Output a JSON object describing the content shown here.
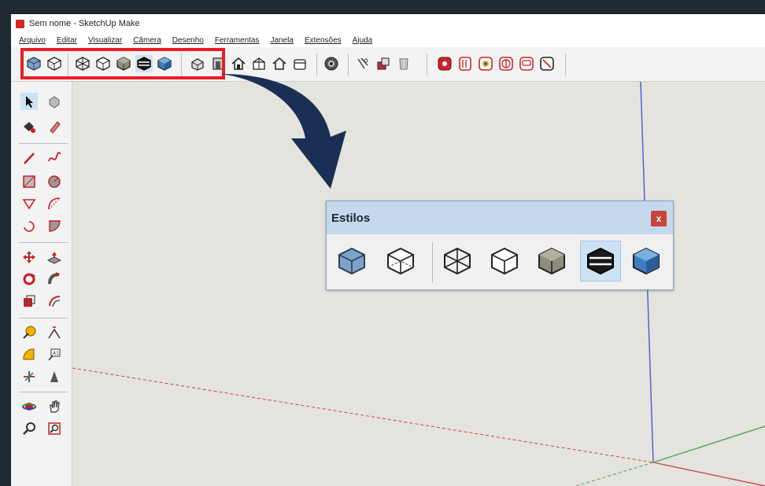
{
  "window": {
    "title": "Sem nome - SketchUp Make"
  },
  "menubar": {
    "items": [
      "Arquivo",
      "Editar",
      "Visualizar",
      "Câmera",
      "Desenho",
      "Ferramentas",
      "Janela",
      "Extensões",
      "Ajuda"
    ]
  },
  "toolbar": {
    "styles_group": [
      "xray-style-icon",
      "back-edges-style-icon",
      "wireframe-style-icon",
      "hidden-line-style-icon",
      "shaded-style-icon",
      "shaded-textures-style-icon",
      "monochrome-style-icon"
    ],
    "views_group": [
      "iso-view-icon",
      "front-view-icon",
      "right-view-icon",
      "top-view-icon",
      "back-view-icon",
      "left-view-icon"
    ],
    "misc_group": [
      "gear-icon",
      "add-location-icon",
      "components-icon",
      "warehouse-icon"
    ],
    "extensions_group": [
      "ext-red-icon",
      "ext-folder-icon",
      "ext-sun-icon",
      "ext-dollar-icon",
      "ext-chat-icon",
      "ext-circle-slash-icon"
    ]
  },
  "styles_panel": {
    "title": "Estilos",
    "close_label": "x",
    "active_index": 5
  },
  "colors": {
    "highlight": "#e81e25",
    "arrow": "#1a2f55",
    "canvas": "#e4e3dd",
    "panel_header": "#c6d8ee",
    "axis_red": "#c84a4a",
    "axis_green": "#4aa84a",
    "axis_blue": "#4a5ad0"
  }
}
